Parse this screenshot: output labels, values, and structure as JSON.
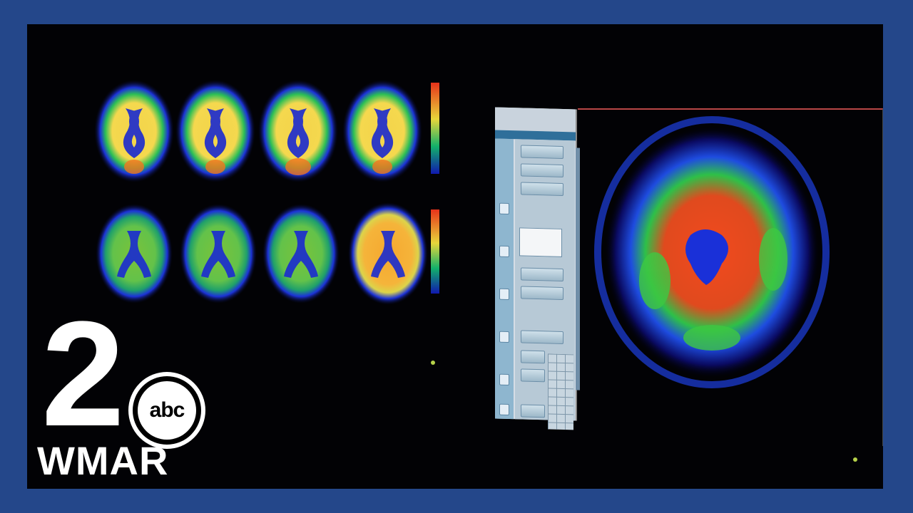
{
  "logo": {
    "channel_number": "2",
    "network": "abc",
    "station": "WMAR"
  },
  "colors": {
    "border_blue": "#24478a",
    "screen_black": "#020205",
    "scan_low": "#1414c8",
    "scan_mid": "#12c06a",
    "scan_high": "#f4d44a",
    "scan_peak": "#f24a1e"
  },
  "icons": [
    "brain-scan-icon",
    "abc-logo-icon"
  ]
}
